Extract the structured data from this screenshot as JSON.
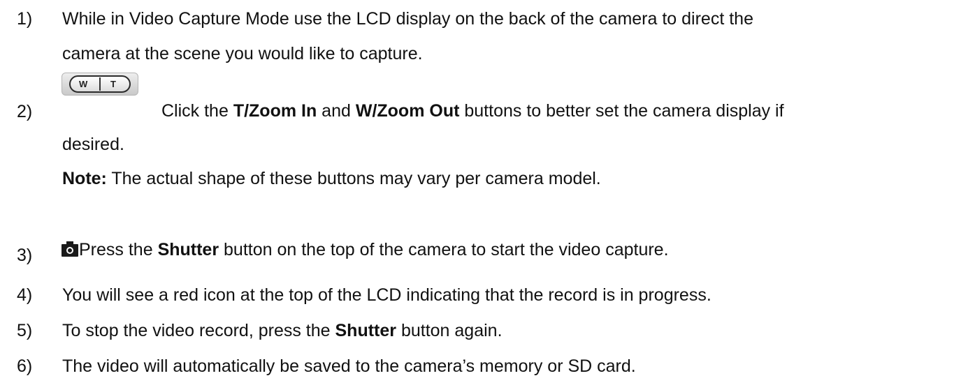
{
  "steps": [
    {
      "number": "1)",
      "lines": [
        [
          "While in Video Capture Mode use the LCD display on the back of the camera to direct the"
        ],
        [
          "camera at the scene you would like to capture."
        ]
      ]
    },
    {
      "number": "2)",
      "icon": "zoom-wt-button-icon",
      "icon_labels": {
        "w": "W",
        "t": "T"
      },
      "line1": {
        "pre": "Click the ",
        "b1": "T/Zoom In",
        "mid": " and ",
        "b2": "W/Zoom Out",
        "post": " buttons to better set the camera display if"
      },
      "line2": "desired.",
      "note": {
        "label": "Note:",
        "text": " The actual shape of these buttons may vary per camera model."
      }
    },
    {
      "number": "3)",
      "icon": "camera-icon",
      "pre": "Press the ",
      "bold": "Shutter",
      "post": " button on the top of the camera to start the video capture."
    },
    {
      "number": "4)",
      "text": "You will see a red icon at the top of the LCD indicating that the record is in progress."
    },
    {
      "number": "5)",
      "pre": "To stop the video record, press the ",
      "bold": "Shutter",
      "post": " button again."
    },
    {
      "number": "6)",
      "text": "The video will automatically be saved to the camera’s memory or SD card."
    }
  ]
}
